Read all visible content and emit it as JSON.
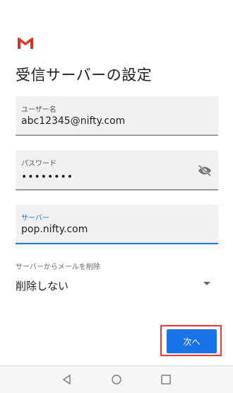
{
  "app": {
    "logo": "gmail-logo-icon"
  },
  "page": {
    "title": "受信サーバーの設定"
  },
  "fields": {
    "username": {
      "label": "ユーザー名",
      "value": "abc12345@nifty.com"
    },
    "password": {
      "label": "パスワード",
      "value": "••••••••",
      "icon": "visibility-off-icon"
    },
    "server": {
      "label": "サーバー",
      "value": "pop.nifty.com"
    }
  },
  "delete_setting": {
    "label": "サーバーからメールを削除",
    "selected": "削除しない"
  },
  "actions": {
    "next_label": "次へ"
  },
  "colors": {
    "accent": "#1a73e8",
    "highlight": "#e53935"
  },
  "navbar": {
    "icons": [
      "back-icon",
      "home-icon",
      "recent-apps-icon"
    ]
  }
}
